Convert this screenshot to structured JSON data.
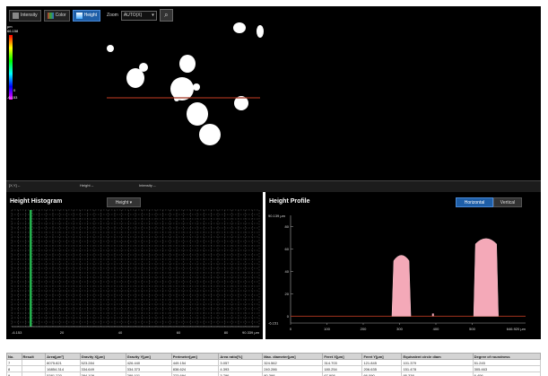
{
  "toolbar": {
    "intensity_label": "Intensity",
    "color_label": "Color",
    "height_label": "Height",
    "zoom_label": "Zoom",
    "zoom_value": "AUTO(X)"
  },
  "colorbar": {
    "max_label": "μm\n66.158",
    "zero_label": "0",
    "min_label": "-6.153"
  },
  "status": {
    "coord_label": "[X,Y]",
    "height_label": "Height",
    "intensity_label": "Intensity"
  },
  "histogram": {
    "title": "Height Histogram",
    "mode": "Height",
    "x_ticks": [
      "-6.153",
      "20",
      "40",
      "60",
      "80",
      "90.339 μm"
    ]
  },
  "profile": {
    "title": "Height Profile",
    "btn_horizontal": "Horizontal",
    "btn_vertical": "Vertical",
    "y_top": "90.139 μm",
    "y_ticks": [
      "80",
      "60",
      "40",
      "20",
      "0",
      "-6.151"
    ],
    "x_ticks": [
      "0",
      "100",
      "200",
      "300",
      "400",
      "500",
      "646.920 μm"
    ]
  },
  "results": {
    "headers": [
      "No.",
      "Result",
      "Area[μm²]",
      "Gravity X[μm]",
      "Gravity Y[μm]",
      "Perimeter[μm]",
      "Area ratio[%]",
      "Max. diameter[μm]",
      "Feret X[μm]",
      "Feret Y[μm]",
      "Equivalent circle diam",
      "Degree of roundness"
    ],
    "rows": [
      [
        "7",
        "",
        "8075.821",
        "523.284",
        "426.440",
        "449.154",
        "3.057",
        "324.562",
        "314.703",
        "121.845",
        "101.379",
        "51.245"
      ],
      [
        "8",
        "",
        "16854.314",
        "334.649",
        "334.373",
        "838.624",
        "4.393",
        "240.286",
        "180.254",
        "206.635",
        "151.478",
        "305.463"
      ],
      [
        "9",
        "",
        "5381.220",
        "384.109",
        "289.101",
        "223.694",
        "3.796",
        "80.398",
        "67.908",
        "66.090",
        "95.338",
        "6.406"
      ]
    ]
  }
}
